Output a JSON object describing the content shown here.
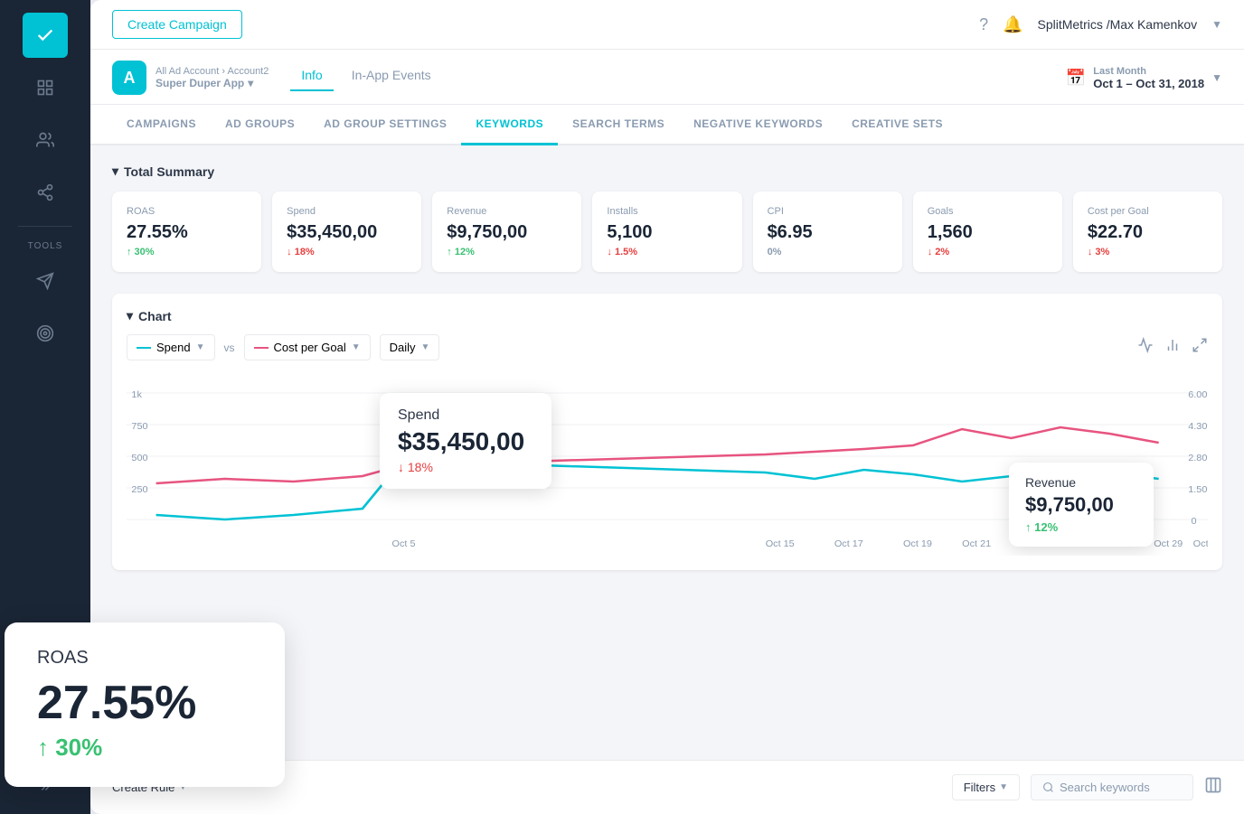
{
  "sidebar": {
    "icons": [
      "check",
      "layout",
      "users",
      "git-branch",
      "send",
      "target",
      "settings",
      "more"
    ]
  },
  "topbar": {
    "create_campaign": "Create Campaign",
    "user": "SplitMetrics /Max Kamenkov",
    "help_icon": "?",
    "bell_icon": "🔔"
  },
  "subheader": {
    "breadcrumb": "All Ad Account › Account2",
    "app_name": "Super Duper App",
    "app_icon": "A",
    "tabs": [
      "Info",
      "In-App Events"
    ],
    "active_tab": "Info",
    "date_label": "Last Month",
    "date_range": "Oct 1 – Oct 31, 2018"
  },
  "nav_tabs": {
    "items": [
      "CAMPAIGNS",
      "AD GROUPS",
      "AD GROUP SETTINGS",
      "KEYWORDS",
      "SEARCH TERMS",
      "NEGATIVE KEYWORDS",
      "CREATIVE SETS"
    ],
    "active": "KEYWORDS"
  },
  "summary": {
    "title": "Total Summary",
    "cards": [
      {
        "label": "ROAS",
        "value": "27.55%",
        "change": "↑ 30%",
        "direction": "up"
      },
      {
        "label": "Spend",
        "value": "$35,450,00",
        "change": "↓ 18%",
        "direction": "down"
      },
      {
        "label": "Revenue",
        "value": "$9,750,00",
        "change": "↑ 12%",
        "direction": "up"
      },
      {
        "label": "Installs",
        "value": "5,100",
        "change": "↓ 1.5%",
        "direction": "down"
      },
      {
        "label": "CPI",
        "value": "$6.95",
        "change": "0%",
        "direction": "neutral"
      },
      {
        "label": "Goals",
        "value": "1,560",
        "change": "↓ 2%",
        "direction": "down"
      },
      {
        "label": "Cost per Goal",
        "value": "$22.70",
        "change": "↓ 3%",
        "direction": "down"
      }
    ]
  },
  "chart": {
    "title": "Chart",
    "selector1": "Spend",
    "selector2": "Cost per Goal",
    "selector3": "Daily",
    "vs_label": "vs"
  },
  "tooltip_spend": {
    "label": "Spend",
    "value": "$35,450,00",
    "change": "↓ 18%"
  },
  "tooltip_revenue": {
    "label": "Revenue",
    "value": "$9,750,00",
    "change": "↑ 12%"
  },
  "big_tooltip": {
    "label": "ROAS",
    "value": "27.55%",
    "change": "↑ 30%"
  },
  "cost_goal": {
    "label": "Cost Goal",
    "value": "$22.70"
  },
  "bottom_bar": {
    "create_rule": "Create Rule",
    "filters": "Filters",
    "search_placeholder": "Search keywords",
    "columns_icon": "columns"
  }
}
